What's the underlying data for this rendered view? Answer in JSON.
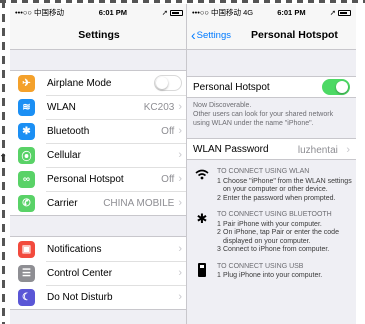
{
  "colors": {
    "accent": "#007aff",
    "toggle_on": "#4cd964",
    "group_bg": "#efeff4"
  },
  "left": {
    "status": {
      "carrier": "•••○○ 中国移动",
      "time": "6:01 PM"
    },
    "title": "Settings",
    "group1": [
      {
        "label": "Airplane Mode",
        "value": "",
        "icon": "airplane-icon",
        "color": "#f4a12b",
        "glyph": "✈",
        "toggle": "off"
      },
      {
        "label": "WLAN",
        "value": "KC203",
        "icon": "wifi-icon",
        "color": "#1b8ff4",
        "glyph": "≋",
        "chevron": true
      },
      {
        "label": "Bluetooth",
        "value": "Off",
        "icon": "bluetooth-icon",
        "color": "#1b8ff4",
        "glyph": "✱",
        "chevron": true
      },
      {
        "label": "Cellular",
        "value": "",
        "icon": "cellular-icon",
        "color": "#59d267",
        "glyph": "⦿",
        "chevron": true
      },
      {
        "label": "Personal Hotspot",
        "value": "Off",
        "icon": "hotspot-icon",
        "color": "#59d267",
        "glyph": "∞",
        "chevron": true
      },
      {
        "label": "Carrier",
        "value": "CHINA MOBILE",
        "icon": "phone-icon",
        "color": "#59d267",
        "glyph": "✆",
        "chevron": true
      }
    ],
    "group2": [
      {
        "label": "Notifications",
        "value": "",
        "icon": "notifications-icon",
        "color": "#f24a3d",
        "glyph": "▣",
        "chevron": true
      },
      {
        "label": "Control Center",
        "value": "",
        "icon": "control-center-icon",
        "color": "#8e8e93",
        "glyph": "☰",
        "chevron": true
      },
      {
        "label": "Do Not Disturb",
        "value": "",
        "icon": "moon-icon",
        "color": "#5a56d6",
        "glyph": "☾",
        "chevron": true
      }
    ]
  },
  "right": {
    "status": {
      "carrier": "•••○○ 中国移动 4G",
      "time": "6:01 PM"
    },
    "back_label": "Settings",
    "title": "Personal Hotspot",
    "hotspot_label": "Personal Hotspot",
    "hotspot_toggle": "on",
    "discover_text": "Now Discoverable.",
    "desc_text": "Other users can look for your shared network using WLAN under the name \"iPhone\".",
    "password_label": "WLAN Password",
    "password_value": "luzhentai",
    "wlan": {
      "title": "TO CONNECT USING WLAN",
      "steps": [
        {
          "n": "1",
          "t": "Choose \"iPhone\" from the WLAN settings on your computer or other device."
        },
        {
          "n": "2",
          "t": "Enter the password when prompted."
        }
      ]
    },
    "bluetooth": {
      "title": "TO CONNECT USING BLUETOOTH",
      "steps": [
        {
          "n": "1",
          "t": "Pair iPhone with your computer."
        },
        {
          "n": "2",
          "t": "On iPhone, tap Pair or enter the code displayed on your computer."
        },
        {
          "n": "3",
          "t": "Connect to iPhone from computer."
        }
      ]
    },
    "usb": {
      "title": "TO CONNECT USING USB",
      "steps": [
        {
          "n": "1",
          "t": "Plug iPhone into your computer."
        }
      ]
    }
  }
}
